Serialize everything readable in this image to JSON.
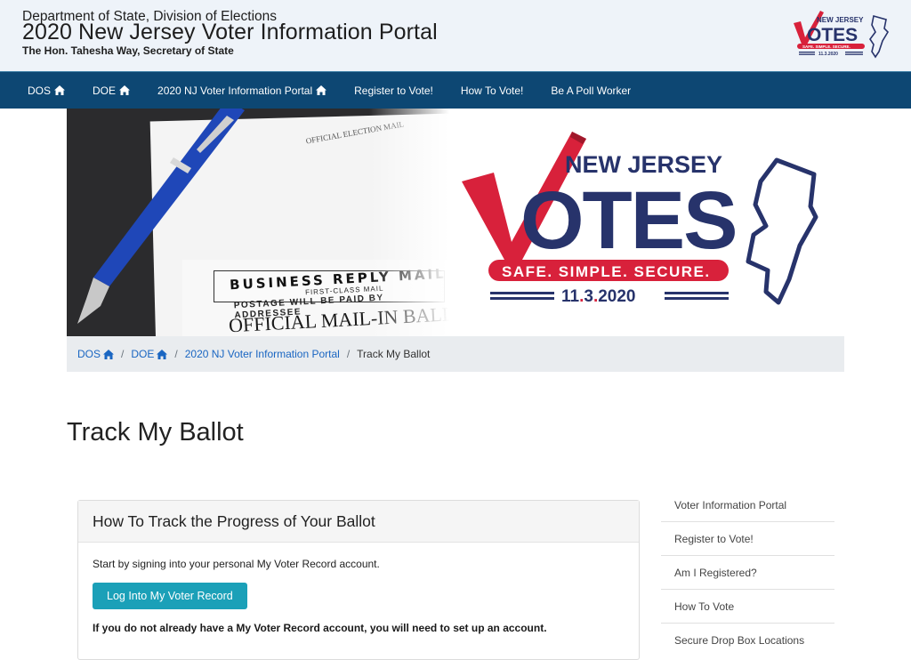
{
  "header": {
    "department": "Department of State, Division of Elections",
    "title": "2020 New Jersey Voter Information Portal",
    "subtitle": "The Hon. Tahesha Way, Secretary of State",
    "logo_alt": "New Jersey Votes logo"
  },
  "nav": {
    "items": [
      {
        "label": "DOS",
        "icon": "home-icon"
      },
      {
        "label": "DOE",
        "icon": "home-icon"
      },
      {
        "label": "2020 NJ Voter Information Portal",
        "icon": "home-icon"
      },
      {
        "label": "Register to Vote!"
      },
      {
        "label": "How To Vote!"
      },
      {
        "label": "Be A Poll Worker"
      }
    ]
  },
  "hero": {
    "photo": {
      "business_reply": "BUSINESS REPLY MAIL",
      "first_class": "FIRST-CLASS MAIL",
      "postage": "POSTAGE WILL BE PAID BY ADDRESSEE",
      "official_ballot": "OFFICIAL MAIL-IN BALLOT",
      "election_mail": "OFFICIAL ELECTION MAIL"
    },
    "logo": {
      "new_jersey": "NEW JERSEY",
      "votes": "OTES",
      "tagline": "SAFE. SIMPLE. SECURE.",
      "date_part1": "11",
      "date_part2": "3",
      "date_part3": "2020"
    }
  },
  "breadcrumb": {
    "items": [
      {
        "label": "DOS",
        "icon": "home-icon"
      },
      {
        "label": "DOE",
        "icon": "home-icon"
      },
      {
        "label": "2020 NJ Voter Information Portal"
      }
    ],
    "separator": "/",
    "current": "Track My Ballot"
  },
  "page": {
    "title": "Track My Ballot"
  },
  "card": {
    "header": "How To Track the Progress of Your Ballot",
    "intro": "Start by signing into your personal My Voter Record account.",
    "button_label": "Log Into My Voter Record",
    "note": "If you do not already have a My Voter Record account, you will need to set up an account."
  },
  "sidebar": {
    "items": [
      {
        "label": "Voter Information Portal"
      },
      {
        "label": "Register to Vote!"
      },
      {
        "label": "Am I Registered?"
      },
      {
        "label": "How To Vote"
      },
      {
        "label": "Secure Drop Box Locations"
      }
    ]
  },
  "colors": {
    "nav_bg": "#0d4773",
    "header_bg": "#eef3f9",
    "brand_red": "#d8213b",
    "brand_navy": "#27336b",
    "button_teal": "#1ba0b8",
    "link_blue": "#1a66c2"
  }
}
